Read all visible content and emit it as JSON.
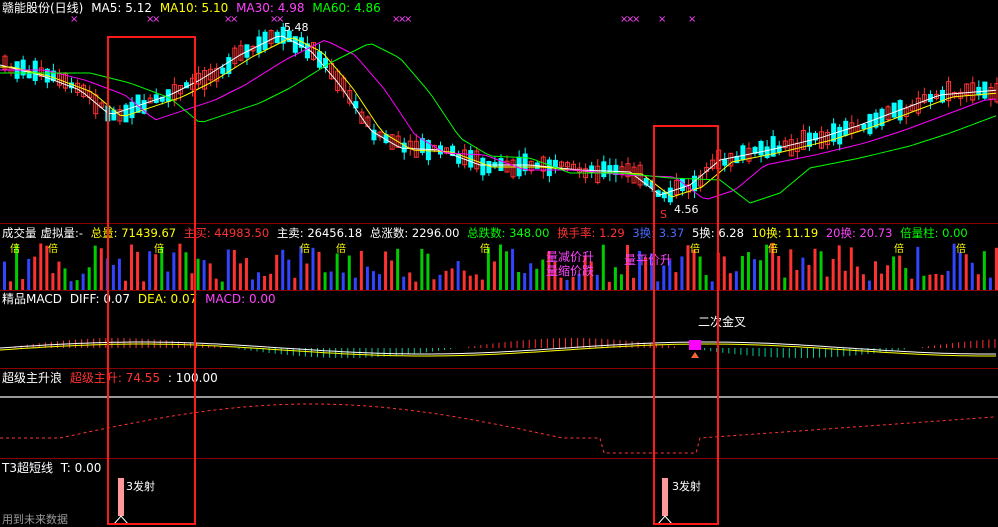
{
  "header": {
    "stock": "赣能股份(日线)",
    "ma5": "MA5: 5.12",
    "ma10": "MA10: 5.10",
    "ma30": "MA30: 4.98",
    "ma60": "MA60: 4.86"
  },
  "price": {
    "high_label": "5.48",
    "low_label": "4.56",
    "low_mark": "S"
  },
  "volume": {
    "labels": [
      "成交量",
      "虚拟量:-",
      "总量: 71439.67",
      "主买: 44983.50",
      "主卖: 26456.18",
      "总涨数: 2296.00",
      "总跌数: 348.00",
      "换手率: 1.29",
      "3换: 3.37",
      "5换: 6.28",
      "10换: 11.19",
      "20换: 20.73",
      "倍量柱: 0.00"
    ],
    "annotation_1": "量减价升",
    "annotation_2": "量缩价跌",
    "annotation_3": "量平价升",
    "bei": "倍"
  },
  "macd": {
    "title": "精品MACD",
    "diff": "DIFF: 0.07",
    "dea": "DEA: 0.07",
    "macd": "MACD: 0.00",
    "signal": "二次金叉"
  },
  "super": {
    "title": "超级主升浪",
    "value": "超级主升: 74.55",
    "level": ": 100.00"
  },
  "t3": {
    "title": "T3超短线",
    "value": "T: 0.00",
    "marker": "3发射",
    "footer": "用到未来数据"
  },
  "colors": {
    "up": "#ff3232",
    "down": "#00ffff",
    "ma5": "#ffffff",
    "ma10": "#ffff00",
    "ma30": "#ff00ff",
    "ma60": "#00ff00",
    "frame": "#ff1a1a"
  }
}
